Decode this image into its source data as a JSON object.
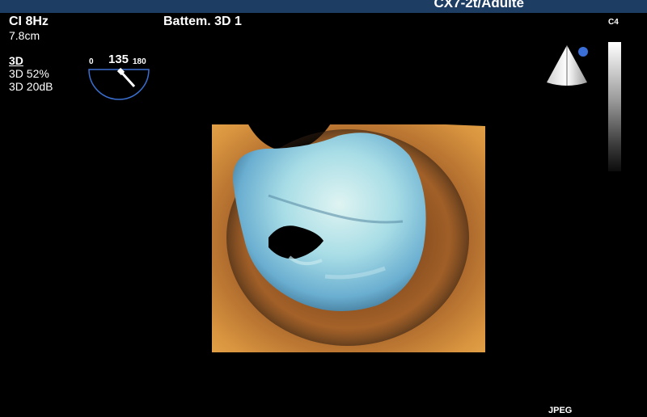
{
  "header": {
    "probe_preset": "CX7-2t/Adulte"
  },
  "left_params": {
    "ci_rate": "CI 8Hz",
    "depth": "7.8cm"
  },
  "mode_params": {
    "mode": "3D",
    "gain": "3D 52%",
    "dynamic_range": "3D 20dB"
  },
  "image_label": "Battem. 3D 1",
  "angle_gauge": {
    "min": "0",
    "value": "135",
    "max": "180",
    "angle_degrees": 135
  },
  "colormap_label": "C4",
  "compression_label": "JPEG",
  "colors": {
    "header_bar": "#1d3d63",
    "gauge_line": "#3a6fd0",
    "probe_dot": "#3a6fd8",
    "tissue_orange": "#d08c3c",
    "valve_blue": "#8fd0e0"
  },
  "icons": {
    "gauge": "angle-gauge-icon",
    "probe": "probe-orientation-icon",
    "grayscale": "grayscale-bar"
  }
}
